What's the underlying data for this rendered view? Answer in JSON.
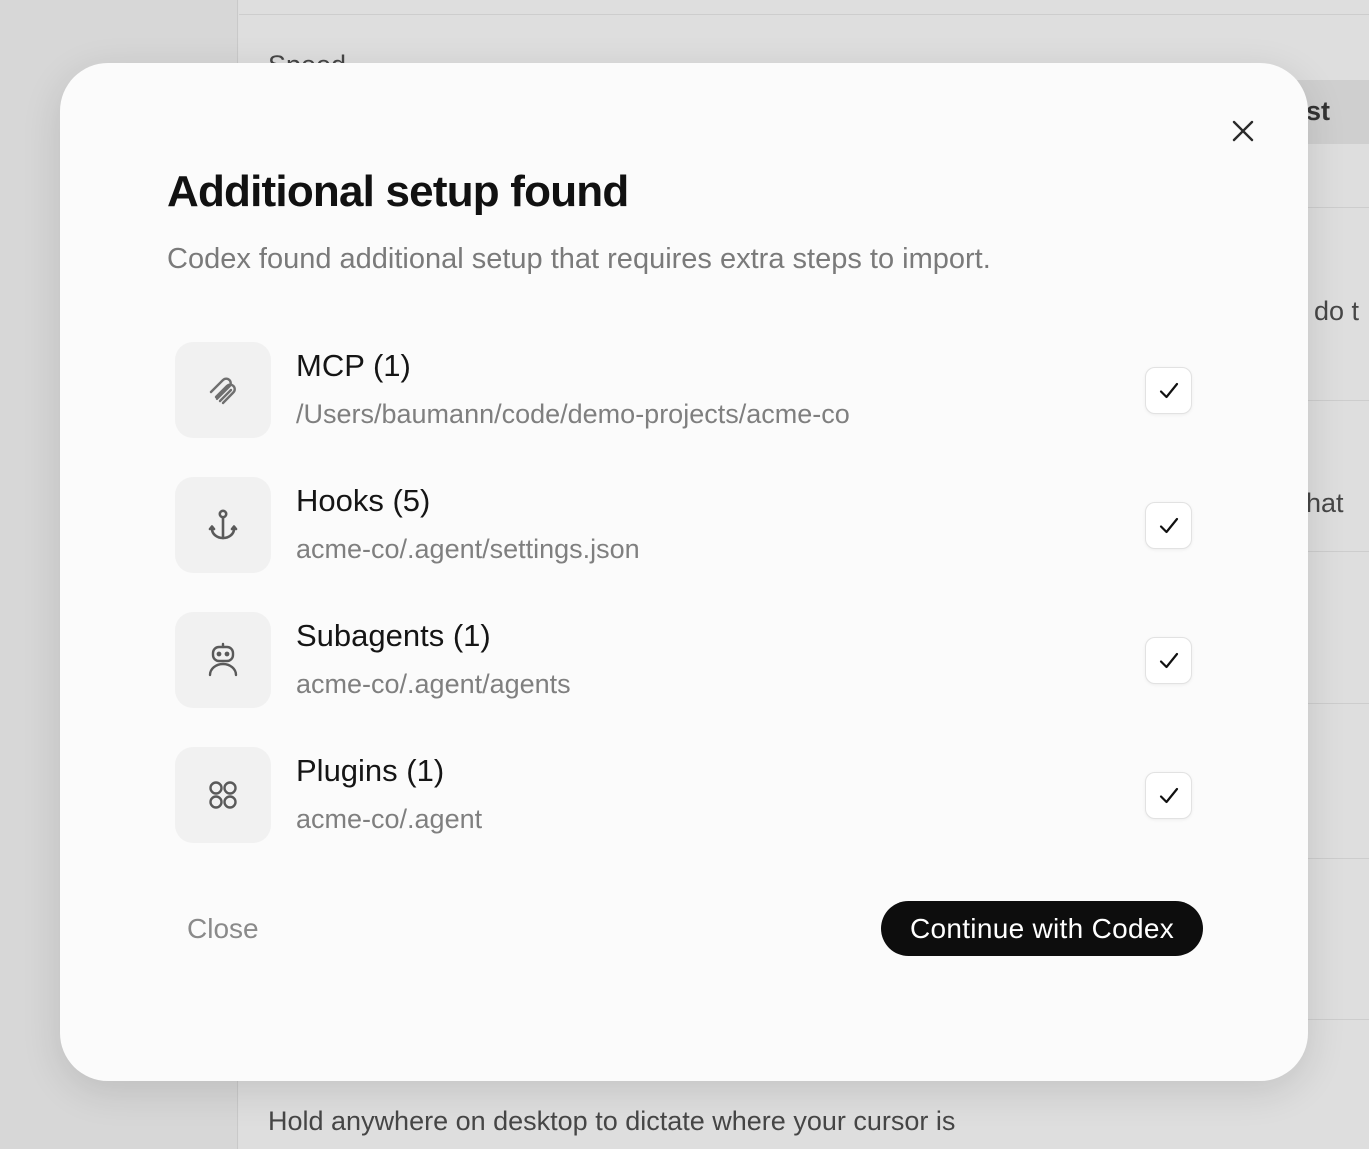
{
  "background": {
    "text_top": "Speed",
    "text_right_1": "st",
    "text_right_2": "do t",
    "text_right_3": "hat",
    "text_bottom": "Hold anywhere on desktop to dictate where your cursor is"
  },
  "modal": {
    "title": "Additional setup found",
    "subtitle": "Codex found additional setup that requires extra steps to import.",
    "items": [
      {
        "title": "MCP (1)",
        "path": "/Users/baumann/code/demo-projects/acme-co",
        "icon": "paperclip-icon",
        "checked": true
      },
      {
        "title": "Hooks (5)",
        "path": "acme-co/.agent/settings.json",
        "icon": "anchor-icon",
        "checked": true
      },
      {
        "title": "Subagents (1)",
        "path": "acme-co/.agent/agents",
        "icon": "robot-icon",
        "checked": true
      },
      {
        "title": "Plugins (1)",
        "path": "acme-co/.agent",
        "icon": "grid-circles-icon",
        "checked": true
      }
    ],
    "close_label": "Close",
    "continue_label": "Continue with Codex"
  }
}
